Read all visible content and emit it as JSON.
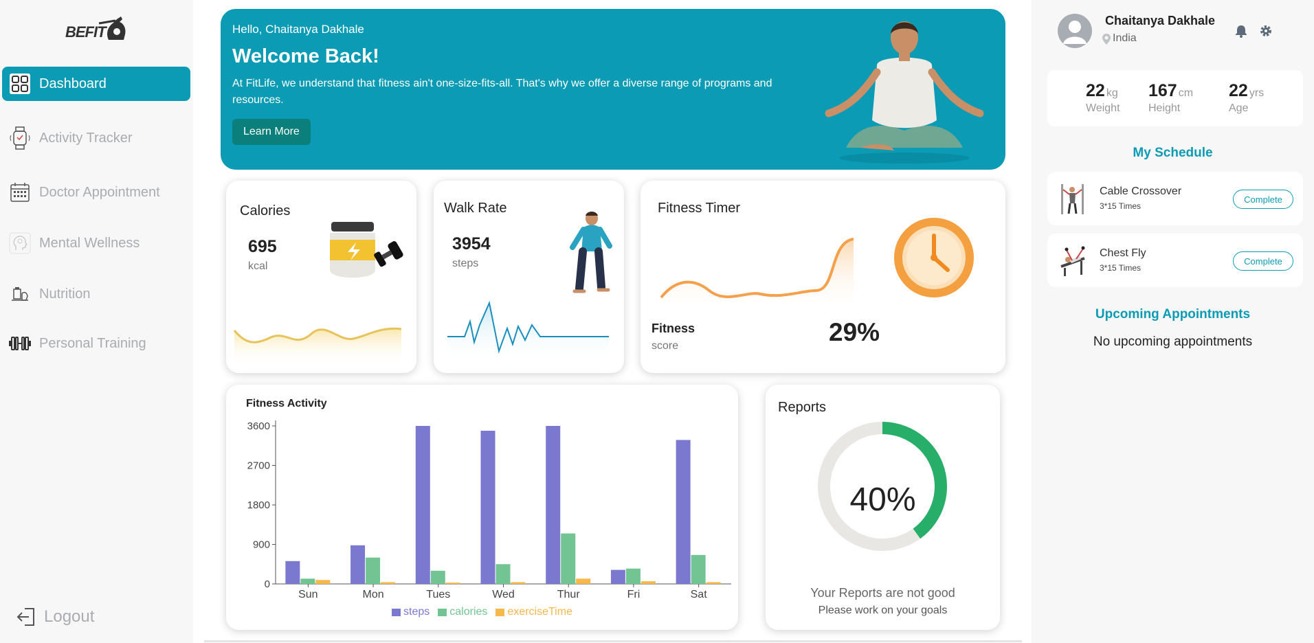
{
  "brand": {
    "logo_text": "BEFIT"
  },
  "sidebar": {
    "items": [
      {
        "label": "Dashboard",
        "icon": "dashboard-grid-icon",
        "active": true
      },
      {
        "label": "Activity Tracker",
        "icon": "smartwatch-icon",
        "active": false
      },
      {
        "label": "Doctor Appointment",
        "icon": "calendar-icon",
        "active": false
      },
      {
        "label": "Mental Wellness",
        "icon": "head-brain-icon",
        "active": false
      },
      {
        "label": "Nutrition",
        "icon": "nutrition-icon",
        "active": false
      },
      {
        "label": "Personal Training",
        "icon": "dumbbell-icon",
        "active": false
      }
    ],
    "logout": "Logout"
  },
  "hero": {
    "greeting": "Hello, Chaitanya Dakhale",
    "title": "Welcome Back!",
    "description": "At FitLife, we understand that fitness ain't one-size-fits-all. That's why we offer a diverse range of programs and resources.",
    "button": "Learn More"
  },
  "calories": {
    "title": "Calories",
    "value": "695",
    "unit": "kcal"
  },
  "walk": {
    "title": "Walk Rate",
    "value": "3954",
    "unit": "steps"
  },
  "timer": {
    "title": "Fitness Timer",
    "score_label": "Fitness",
    "score_sub": "score",
    "score_value": "29%"
  },
  "activity": {
    "title": "Fitness Activity"
  },
  "chart_data": {
    "type": "bar",
    "title": "Fitness Activity",
    "categories": [
      "Sun",
      "Mon",
      "Tues",
      "Wed",
      "Thur",
      "Fri",
      "Sat"
    ],
    "series": [
      {
        "name": "steps",
        "color": "#7b78d0",
        "values": [
          520,
          880,
          3600,
          3490,
          3600,
          320,
          3280
        ]
      },
      {
        "name": "calories",
        "color": "#73c493",
        "values": [
          120,
          600,
          300,
          450,
          1150,
          350,
          660
        ]
      },
      {
        "name": "exerciseTime",
        "color": "#f5b84a",
        "values": [
          90,
          40,
          30,
          40,
          120,
          60,
          40
        ]
      }
    ],
    "ylim": [
      0,
      3600
    ],
    "yticks": [
      "0",
      "900",
      "1800",
      "2700",
      "3600"
    ],
    "legend": "bottom"
  },
  "reports": {
    "title": "Reports",
    "percent_text": "40%",
    "percent": 40,
    "msg1": "Your Reports are not good",
    "msg2": "Please work on your goals"
  },
  "profile": {
    "name": "Chaitanya Dakhale",
    "location": "India"
  },
  "stats": [
    {
      "value": "22",
      "unit": "kg",
      "label": "Weight"
    },
    {
      "value": "167",
      "unit": "cm",
      "label": "Height"
    },
    {
      "value": "22",
      "unit": "yrs",
      "label": "Age"
    }
  ],
  "schedule": {
    "title": "My Schedule",
    "items": [
      {
        "name": "Cable Crossover",
        "reps": "3*15 Times",
        "button": "Complete"
      },
      {
        "name": "Chest Fly",
        "reps": "3*15 Times",
        "button": "Complete"
      }
    ]
  },
  "appointments": {
    "title": "Upcoming Appointments",
    "empty": "No upcoming appointments"
  }
}
